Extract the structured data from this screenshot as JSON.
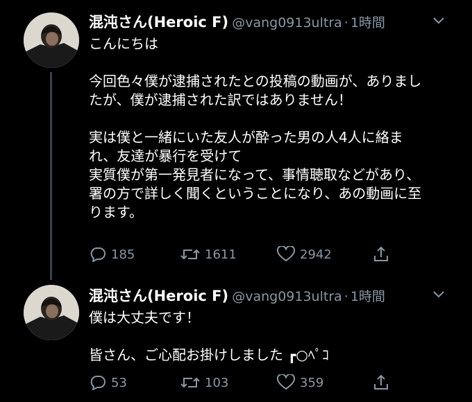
{
  "colors": {
    "background": "#000000",
    "text": "#ffffff",
    "muted": "#8899a6",
    "thread_line": "#3a444c"
  },
  "tweets": [
    {
      "name": "混沌さん(Heroic F)",
      "handle": "@vang0913ultra",
      "separator": "·",
      "time": "1時間",
      "lines": [
        "こんにちは",
        "",
        "今回色々僕が逮捕されたとの投稿の動画が、ありまし",
        "たが、僕が逮捕された訳ではありません！",
        "",
        "実は僕と一緒にいた友人が酔った男の人4人に絡ま",
        "れ、友達が暴行を受けて",
        "実質僕が第一発見者になって、事情聴取などがあり、",
        "署の方で詳しく聞くということになり、あの動画に至",
        "ります。"
      ],
      "replies": "185",
      "retweets": "1611",
      "likes": "2942",
      "icons": [
        "reply-icon",
        "retweet-icon",
        "like-icon",
        "share-icon"
      ]
    },
    {
      "name": "混沌さん(Heroic F)",
      "handle": "@vang0913ultra",
      "separator": "·",
      "time": "1時間",
      "lines": [
        "僕は大丈夫です！",
        "",
        "皆さん、ご心配お掛けしました ┏○ﾍﾟｺ"
      ],
      "replies": "53",
      "retweets": "103",
      "likes": "359",
      "icons": [
        "reply-icon",
        "retweet-icon",
        "like-icon",
        "share-icon"
      ]
    }
  ]
}
